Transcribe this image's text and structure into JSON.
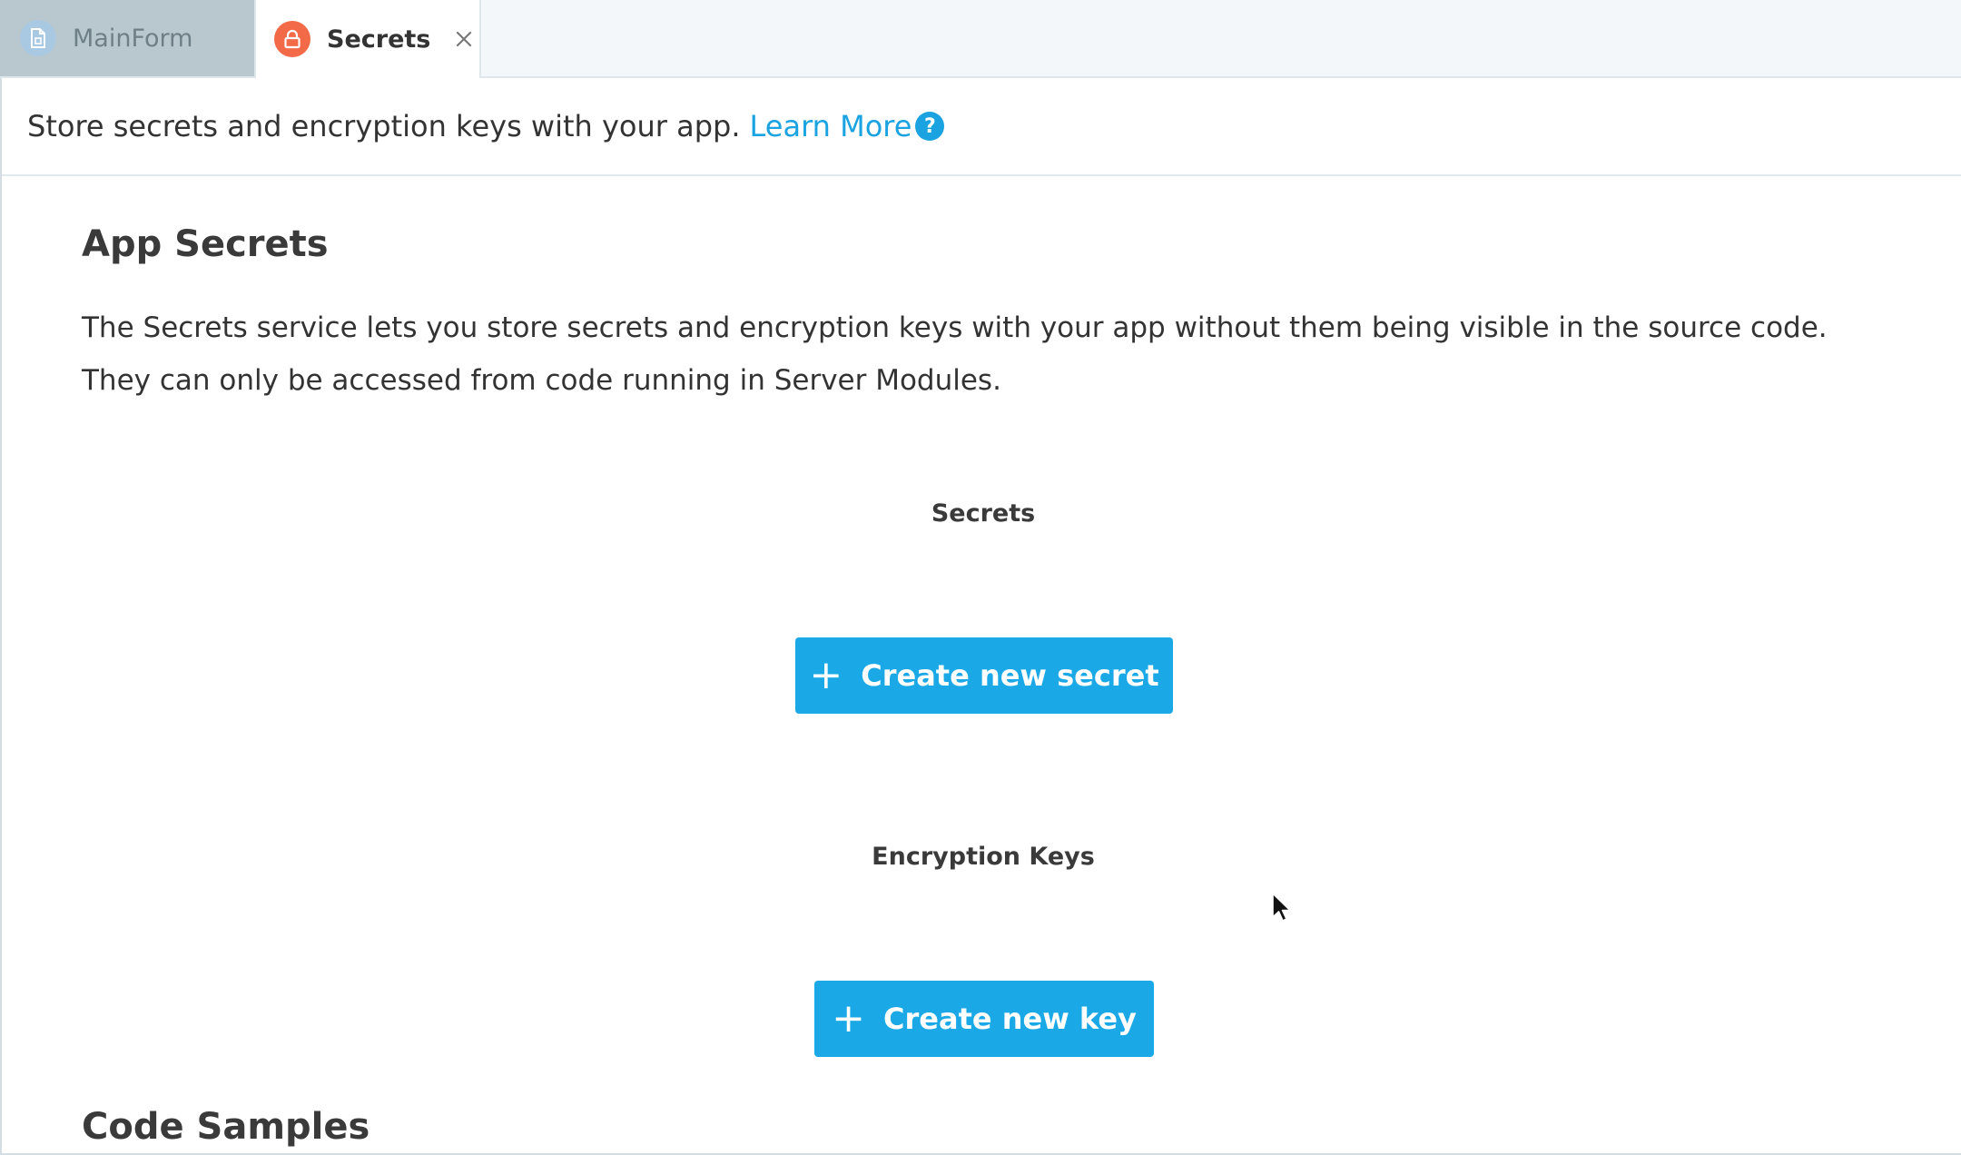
{
  "tabs": [
    {
      "label": "MainForm",
      "icon": "form-file-icon",
      "active": false
    },
    {
      "label": "Secrets",
      "icon": "lock-icon",
      "active": true
    }
  ],
  "infobar": {
    "text": "Store secrets and encryption keys with your app.",
    "link_label": "Learn More",
    "help_glyph": "?"
  },
  "main": {
    "title": "App Secrets",
    "description": "The Secrets service lets you store secrets and encryption keys with your app without them being visible in the source code. They can only be accessed from code running in Server Modules.",
    "secrets_heading": "Secrets",
    "create_secret_label": "Create new secret",
    "keys_heading": "Encryption Keys",
    "create_key_label": "Create new key",
    "code_samples_title": "Code Samples"
  },
  "colors": {
    "accent": "#1aa8e6",
    "link": "#1aa3e0",
    "secrets_tab_icon": "#f26a48",
    "mainform_tab_icon": "#a9c9e2",
    "inactive_tab_bg": "#b9c8cf"
  }
}
